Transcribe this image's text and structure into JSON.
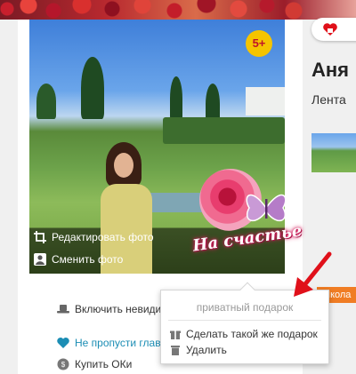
{
  "photo": {
    "age_badge": "5+",
    "edit_label": "Редактировать фото",
    "change_label": "Сменить фото"
  },
  "sticker": {
    "text": "На счастье"
  },
  "profile": {
    "name": "Аня",
    "feed_tab": "Лента",
    "school_tag": "Школа"
  },
  "menu": {
    "invisible_label": "Включить невиди",
    "dont_miss_label": "Не пропусти глав",
    "buy_ok_label": "Купить ОКи"
  },
  "popup": {
    "title": "приватный подарок",
    "same_gift_label": "Сделать такой же подарок",
    "delete_label": "Удалить"
  },
  "colors": {
    "accent_orange": "#f07d24",
    "badge_yellow": "#f5c400",
    "link_teal": "#1b8db4",
    "arrow_red": "#e0101a"
  }
}
